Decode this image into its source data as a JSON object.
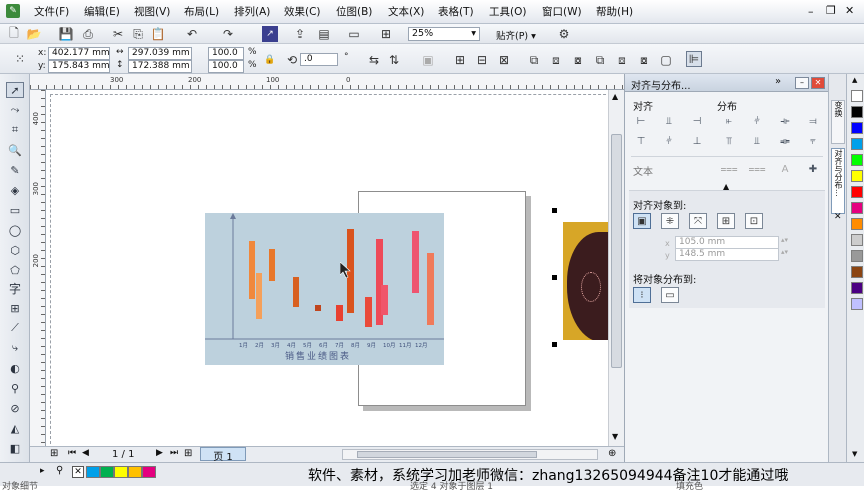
{
  "menu": {
    "items": [
      "文件(F)",
      "编辑(E)",
      "视图(V)",
      "布局(L)",
      "排列(A)",
      "效果(C)",
      "位图(B)",
      "文本(X)",
      "表格(T)",
      "工具(O)",
      "窗口(W)",
      "帮助(H)"
    ]
  },
  "toolbar": {
    "zoom": "25%",
    "snap": "贴齐(P)"
  },
  "props": {
    "x": "402.177 mm",
    "y": "175.843 mm",
    "width": "297.039 mm",
    "height": "172.388 mm",
    "scale_x": "100.0",
    "scale_y": "100.0",
    "percent": "%",
    "rotation": ".0",
    "degree": "°",
    "x_label": "x:",
    "y_label": "y:"
  },
  "rulers": {
    "h_ticks": [
      "300",
      "200",
      "100",
      "0"
    ],
    "v_ticks": [
      "400",
      "300",
      "200"
    ]
  },
  "chart_data": {
    "type": "bar",
    "title": "销售业绩图表",
    "categories": [
      "1月",
      "2月",
      "3月",
      "4月",
      "5月",
      "6月",
      "7月",
      "8月",
      "9月",
      "10月",
      "11月",
      "12月"
    ]
  },
  "navigation": {
    "page_count": "1 / 1",
    "page_tab": "页 1"
  },
  "docker": {
    "title": "对齐与分布...",
    "align_header": "对齐",
    "distribute_header": "分布",
    "text_label": "文本",
    "align_to_label": "对齐对象到:",
    "field1": "105.0 mm",
    "field2": "148.5 mm",
    "distribute_to_label": "将对象分布到:"
  },
  "sidetabs": [
    "变换",
    "对齐与分布..."
  ],
  "status": {
    "left": "对象细节",
    "middle": "选定 4 对象于图层 1",
    "right": "填充色"
  },
  "watermark": "软件、素材，系统学习加老师微信：zhang13265094944备注10才能通过哦",
  "palette_colors": [
    "#ffffff",
    "#000000",
    "#0000ff",
    "#00a0e9",
    "#00ff00",
    "#ffff00",
    "#ff0000",
    "#e4007f",
    "#ff8c00",
    "#cccccc",
    "#999999",
    "#8b4513",
    "#4b0082",
    "#c0c0ff"
  ],
  "bottom_swatches": [
    "#00a0e9",
    "#00b050",
    "#ffff00",
    "#ffc000",
    "#e4007f"
  ]
}
